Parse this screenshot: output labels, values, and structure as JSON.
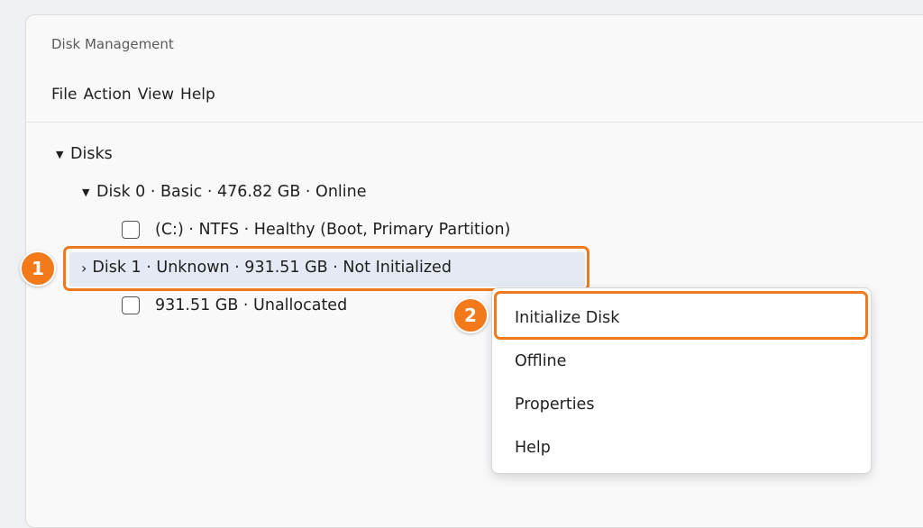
{
  "window": {
    "title": "Disk Management"
  },
  "menubar": {
    "file": "File",
    "action": "Action",
    "view": "View",
    "help": "Help"
  },
  "tree": {
    "root_label": "Disks",
    "disk0_label": "Disk 0 · Basic · 476.82 GB · Online",
    "disk0_partition": "(C:) · NTFS · Healthy (Boot, Primary Partition)",
    "disk1_label": "Disk 1 · Unknown · 931.51 GB · Not Initialized",
    "disk1_partition": "931.51 GB · Unallocated"
  },
  "context_menu": {
    "items": [
      "Initialize Disk",
      "Offline",
      "Properties",
      "Help"
    ]
  },
  "annotations": {
    "step1": "1",
    "step2": "2"
  },
  "colors": {
    "accent": "#f07a1b",
    "selection": "#e4e9f3",
    "background": "#eef0f3"
  }
}
